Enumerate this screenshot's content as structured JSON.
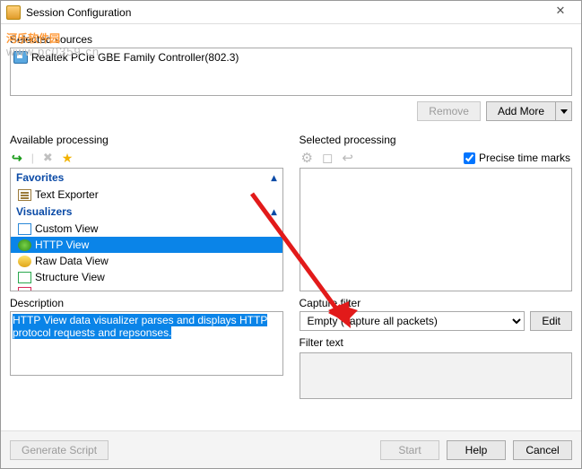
{
  "window": {
    "title": "Session Configuration",
    "close": "✕"
  },
  "watermark": {
    "text": "河乐软件园",
    "url": "www.pc0359.cn"
  },
  "sources": {
    "label": "Selected sources",
    "items": [
      {
        "name": "Realtek PCIe GBE Family Controller(802.3)"
      }
    ],
    "remove": "Remove",
    "addmore": "Add More"
  },
  "available": {
    "label": "Available processing",
    "groups": [
      {
        "name": "Favorites",
        "items": [
          {
            "name": "Text Exporter",
            "ic": "i-doc"
          }
        ]
      },
      {
        "name": "Visualizers",
        "items": [
          {
            "name": "Custom View",
            "ic": "i-cv"
          },
          {
            "name": "HTTP View",
            "ic": "i-hv",
            "sel": true
          },
          {
            "name": "Raw Data View",
            "ic": "i-rv"
          },
          {
            "name": "Structure View",
            "ic": "i-sv"
          }
        ]
      }
    ]
  },
  "selected": {
    "label": "Selected processing",
    "precise": "Precise time marks"
  },
  "description": {
    "label": "Description",
    "text": "HTTP View data visualizer parses and displays HTTP protocol requests and repsonses."
  },
  "filter": {
    "label": "Capture filter",
    "value": "Empty (capture all packets)",
    "edit": "Edit",
    "text_label": "Filter text"
  },
  "footer": {
    "gen": "Generate Script",
    "start": "Start",
    "help": "Help",
    "cancel": "Cancel"
  }
}
